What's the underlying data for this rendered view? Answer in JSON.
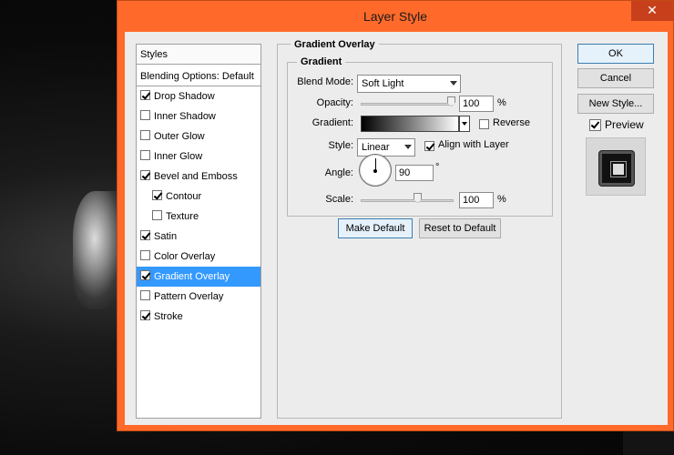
{
  "window": {
    "title": "Layer Style",
    "close_glyph": "✕"
  },
  "styles_panel": {
    "header": "Styles",
    "blending_options": "Blending Options: Default",
    "items": [
      {
        "label": "Drop Shadow",
        "checked": true
      },
      {
        "label": "Inner Shadow",
        "checked": false
      },
      {
        "label": "Outer Glow",
        "checked": false
      },
      {
        "label": "Inner Glow",
        "checked": false
      },
      {
        "label": "Bevel and Emboss",
        "checked": true
      },
      {
        "label": "Contour",
        "checked": true
      },
      {
        "label": "Texture",
        "checked": false
      },
      {
        "label": "Satin",
        "checked": true
      },
      {
        "label": "Color Overlay",
        "checked": false
      },
      {
        "label": "Gradient Overlay",
        "checked": true,
        "selected": true
      },
      {
        "label": "Pattern Overlay",
        "checked": false
      },
      {
        "label": "Stroke",
        "checked": true
      }
    ]
  },
  "gradient_overlay": {
    "title": "Gradient Overlay",
    "sub_title": "Gradient",
    "blend_mode_label": "Blend Mode:",
    "blend_mode_value": "Soft Light",
    "opacity_label": "Opacity:",
    "opacity_value": "100",
    "opacity_unit": "%",
    "opacity_level": 1.0,
    "gradient_label": "Gradient:",
    "reverse_label": "Reverse",
    "reverse_checked": false,
    "style_label": "Style:",
    "style_value": "Linear",
    "align_label": "Align with Layer",
    "align_checked": true,
    "angle_label": "Angle:",
    "angle_value": "90",
    "angle_unit": "°",
    "scale_label": "Scale:",
    "scale_value": "100",
    "scale_unit": "%",
    "scale_level": 0.5,
    "make_default_label": "Make Default",
    "reset_default_label": "Reset to Default"
  },
  "right_buttons": {
    "ok_label": "OK",
    "cancel_label": "Cancel",
    "new_style_label": "New Style...",
    "preview_label": "Preview",
    "preview_checked": true
  },
  "colors": {
    "titlebar": "#ff6a2a",
    "selection": "#3399ff",
    "dialog_bg": "#ececec"
  }
}
